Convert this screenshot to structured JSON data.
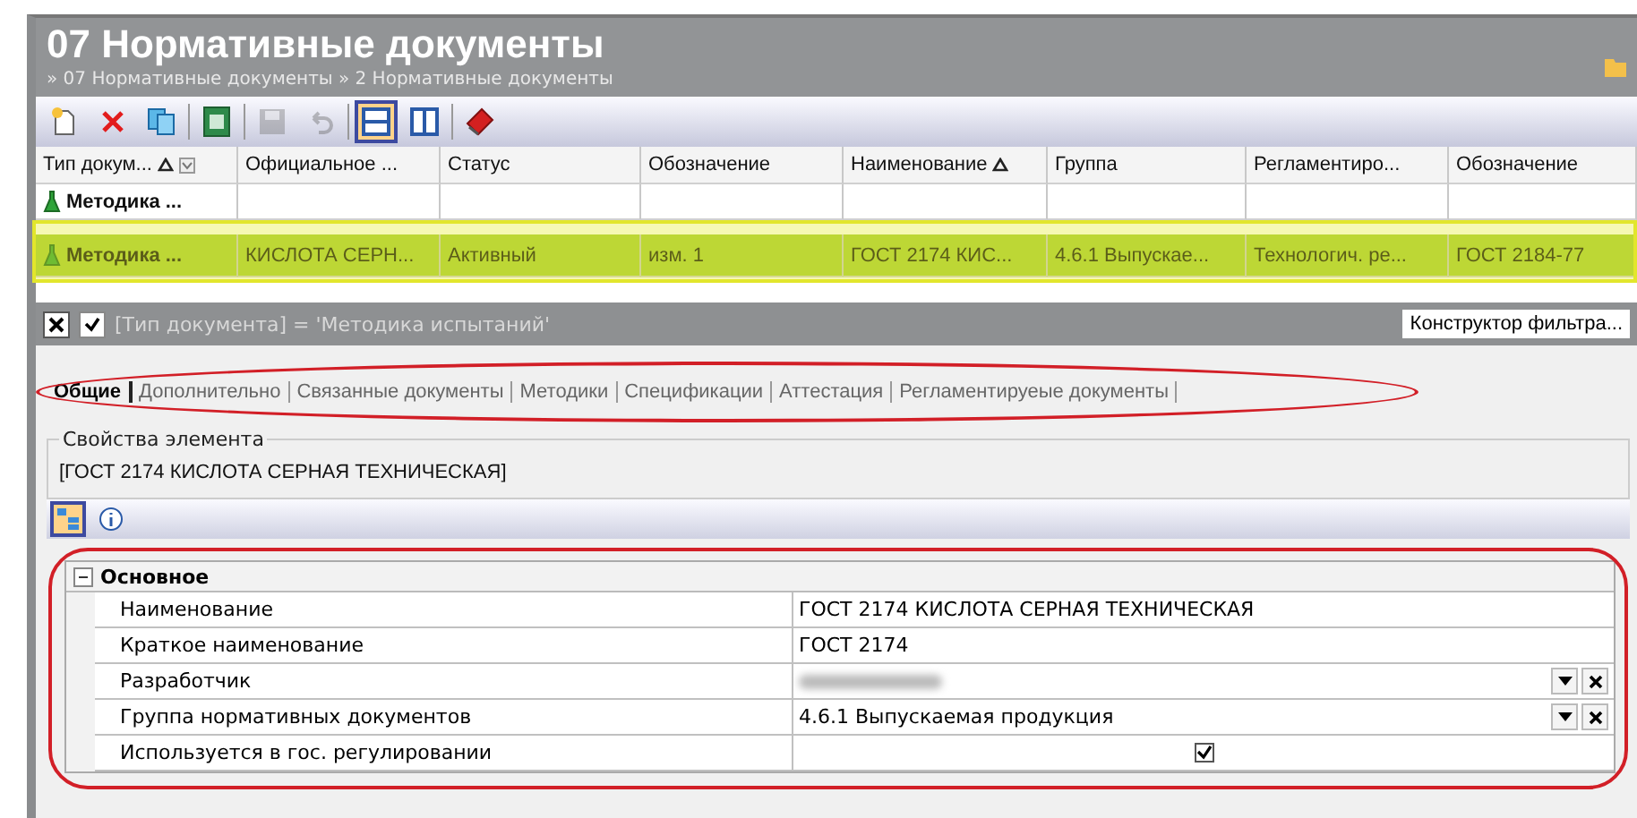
{
  "window": {
    "title": "07 Нормативные документы",
    "breadcrumb": "» 07 Нормативные документы » 2 Нормативные документы"
  },
  "toolbar": [
    {
      "kind": "new",
      "disabled": false,
      "selected": false
    },
    {
      "kind": "delete",
      "disabled": false,
      "selected": false
    },
    {
      "kind": "copy",
      "disabled": false,
      "selected": false
    },
    {
      "kind": "sep"
    },
    {
      "kind": "export",
      "disabled": false,
      "selected": false
    },
    {
      "kind": "sep"
    },
    {
      "kind": "save",
      "disabled": true,
      "selected": false
    },
    {
      "kind": "undo",
      "disabled": true,
      "selected": false
    },
    {
      "kind": "sep"
    },
    {
      "kind": "split-horizontal",
      "disabled": false,
      "selected": true
    },
    {
      "kind": "split-vertical",
      "disabled": false,
      "selected": false
    },
    {
      "kind": "sep"
    },
    {
      "kind": "book",
      "disabled": false,
      "selected": false
    }
  ],
  "table": {
    "columns": [
      {
        "label": "Тип докум...",
        "sorted": true,
        "filter": true
      },
      {
        "label": "Официальное ...",
        "sorted": false,
        "filter": false
      },
      {
        "label": "Статус",
        "sorted": false,
        "filter": false
      },
      {
        "label": "Обозначение",
        "sorted": false,
        "filter": false
      },
      {
        "label": "Наименование",
        "sorted": true,
        "filter": false
      },
      {
        "label": "Группа",
        "sorted": false,
        "filter": false
      },
      {
        "label": "Регламентиро...",
        "sorted": false,
        "filter": false
      },
      {
        "label": "Обозначение",
        "sorted": false,
        "filter": false
      }
    ],
    "rows": [
      {
        "selected": false,
        "cells": [
          "Методика ...",
          "",
          "",
          "",
          "",
          "",
          "",
          ""
        ]
      },
      {
        "selected": true,
        "cells": [
          "Методика ...",
          "КИСЛОТА СЕРН...",
          "Активный",
          "изм. 1",
          "ГОСТ 2174 КИС...",
          "4.6.1 Выпускае...",
          "Технологич. ре...",
          "ГОСТ 2184-77"
        ]
      }
    ]
  },
  "filter": {
    "enabled": true,
    "text": "[Тип документа] = 'Методика испытаний'",
    "button": "Конструктор фильтра..."
  },
  "tabs": [
    {
      "label": "Общие",
      "selected": true
    },
    {
      "label": "Дополнительно",
      "selected": false
    },
    {
      "label": "Связанные документы",
      "selected": false
    },
    {
      "label": "Методики",
      "selected": false
    },
    {
      "label": "Спецификации",
      "selected": false
    },
    {
      "label": "Аттестация",
      "selected": false
    },
    {
      "label": "Регламентируеые документы",
      "selected": false
    }
  ],
  "properties": {
    "group_title": "Свойства элемента",
    "element_name": "[ГОСТ 2174 КИСЛОТА СЕРНАЯ ТЕХНИЧЕСКАЯ]",
    "view_buttons": [
      {
        "kind": "categorized",
        "selected": true
      },
      {
        "kind": "info",
        "selected": false
      }
    ],
    "section": {
      "title": "Основное",
      "expanded": true,
      "rows": [
        {
          "kind": "text",
          "label": "Наименование",
          "value": "ГОСТ 2174 КИСЛОТА СЕРНАЯ ТЕХНИЧЕСКАЯ"
        },
        {
          "kind": "text",
          "label": "Краткое наименование",
          "value": "ГОСТ 2174"
        },
        {
          "kind": "redacted",
          "label": "Разработчик"
        },
        {
          "kind": "lookup",
          "label": "Группа нормативных документов",
          "value": "4.6.1 Выпускаемая продукция"
        },
        {
          "kind": "checkbox",
          "label": "Используется в гос. регулировании",
          "checked": true
        }
      ]
    }
  }
}
